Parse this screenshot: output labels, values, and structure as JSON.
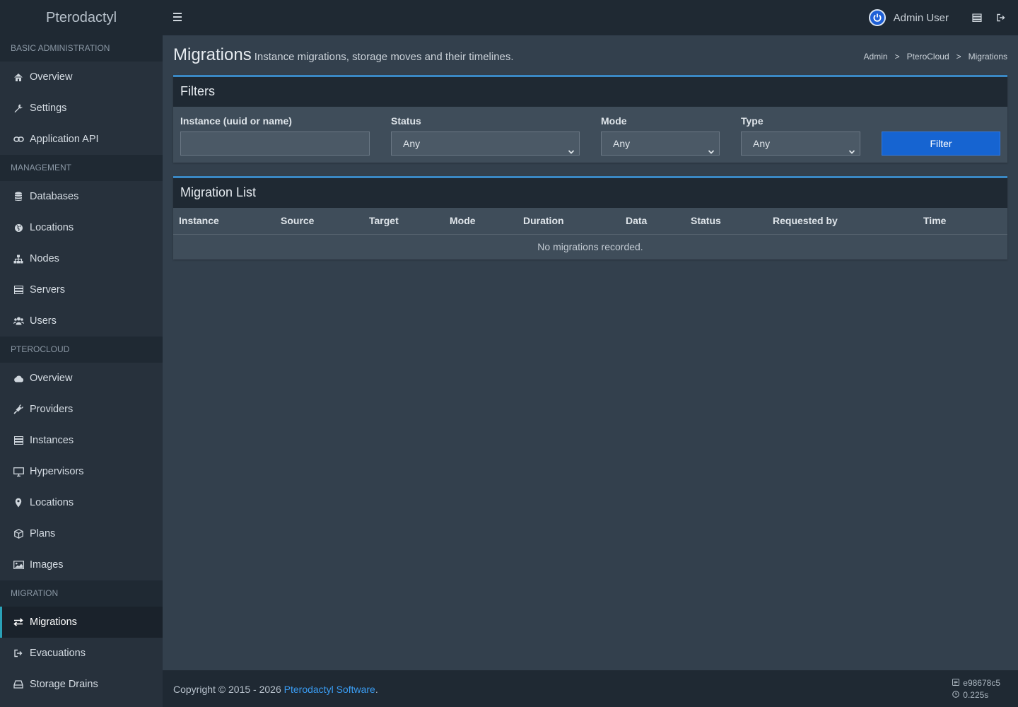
{
  "app": {
    "brand": "Pterodactyl"
  },
  "topbar": {
    "username": "Admin User"
  },
  "sidebar": {
    "sections": [
      {
        "header": "Basic Administration",
        "items": [
          {
            "label": "Overview",
            "icon": "home-icon"
          },
          {
            "label": "Settings",
            "icon": "wrench-icon"
          },
          {
            "label": "Application API",
            "icon": "link-icon"
          }
        ]
      },
      {
        "header": "Management",
        "items": [
          {
            "label": "Databases",
            "icon": "database-icon"
          },
          {
            "label": "Locations",
            "icon": "globe-icon"
          },
          {
            "label": "Nodes",
            "icon": "sitemap-icon"
          },
          {
            "label": "Servers",
            "icon": "server-icon"
          },
          {
            "label": "Users",
            "icon": "users-icon"
          }
        ]
      },
      {
        "header": "PteroCloud",
        "items": [
          {
            "label": "Overview",
            "icon": "cloud-icon"
          },
          {
            "label": "Providers",
            "icon": "plug-icon"
          },
          {
            "label": "Instances",
            "icon": "server-icon"
          },
          {
            "label": "Hypervisors",
            "icon": "desktop-icon"
          },
          {
            "label": "Locations",
            "icon": "map-marker-icon"
          },
          {
            "label": "Plans",
            "icon": "cube-icon"
          },
          {
            "label": "Images",
            "icon": "image-icon"
          }
        ]
      },
      {
        "header": "Migration",
        "items": [
          {
            "label": "Migrations",
            "icon": "exchange-icon",
            "active": true
          },
          {
            "label": "Evacuations",
            "icon": "sign-out-icon"
          },
          {
            "label": "Storage Drains",
            "icon": "hdd-icon"
          }
        ]
      }
    ]
  },
  "page": {
    "title": "Migrations",
    "subtitle": "Instance migrations, storage moves and their timelines.",
    "breadcrumb": [
      "Admin",
      "PteroCloud",
      "Migrations"
    ],
    "breadcrumb_sep": ">"
  },
  "filters": {
    "title": "Filters",
    "instance_label": "Instance (uuid or name)",
    "instance_value": "",
    "status_label": "Status",
    "status_value": "Any",
    "mode_label": "Mode",
    "mode_value": "Any",
    "type_label": "Type",
    "type_value": "Any",
    "button": "Filter"
  },
  "migration_list": {
    "title": "Migration List",
    "columns": [
      "Instance",
      "Source",
      "Target",
      "Mode",
      "Duration",
      "Data",
      "Status",
      "Requested by",
      "Time"
    ],
    "empty": "No migrations recorded."
  },
  "footer": {
    "copyright_prefix": "Copyright © 2015 - 2026 ",
    "link": "Pterodactyl Software",
    "suffix": ".",
    "commit": "e98678c5",
    "time": "0.225s"
  },
  "colors": {
    "accent": "#1664d1",
    "active_bar": "#2aa1b7",
    "box_border": "#3a88c4"
  }
}
